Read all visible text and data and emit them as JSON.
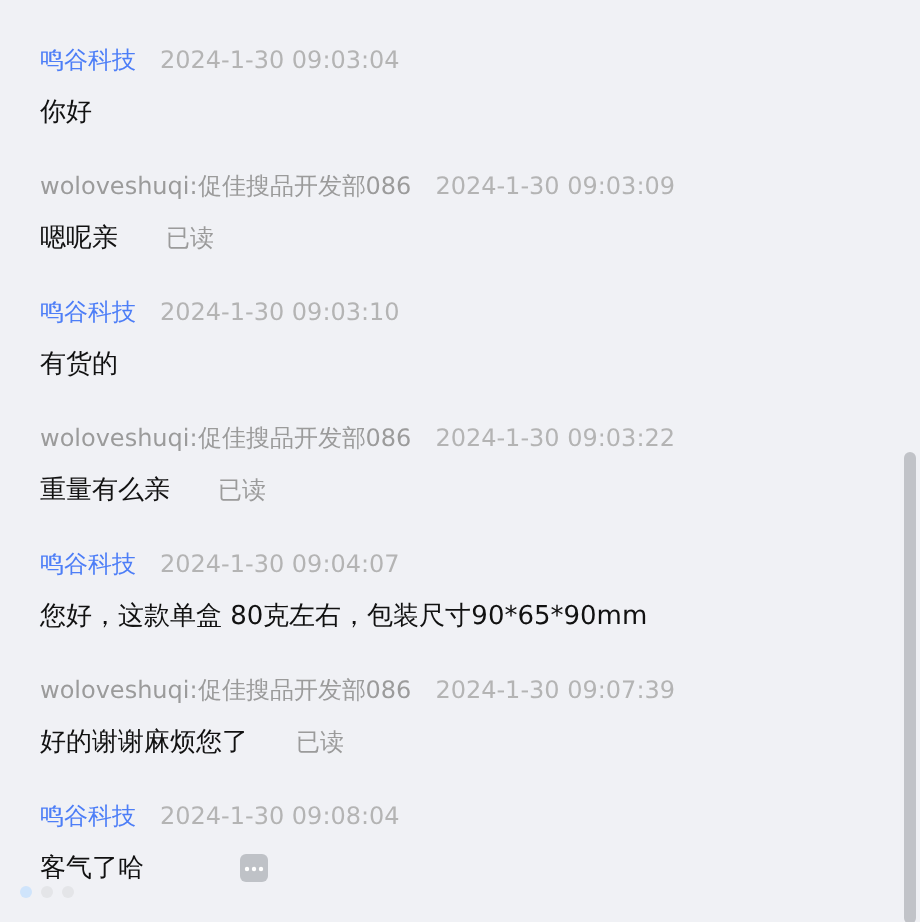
{
  "messages": [
    {
      "sender": "鸣谷科技",
      "kind": "shop",
      "time": "2024-1-30 09:03:04",
      "text": "你好"
    },
    {
      "sender": "woloveshuqi:促佳搜品开发部086",
      "kind": "customer",
      "time": "2024-1-30 09:03:09",
      "text": "嗯呢亲",
      "status": "已读"
    },
    {
      "sender": "鸣谷科技",
      "kind": "shop",
      "time": "2024-1-30 09:03:10",
      "text": "有货的"
    },
    {
      "sender": "woloveshuqi:促佳搜品开发部086",
      "kind": "customer",
      "time": "2024-1-30 09:03:22",
      "text": "重量有么亲",
      "status": "已读"
    },
    {
      "sender": "鸣谷科技",
      "kind": "shop",
      "time": "2024-1-30 09:04:07",
      "text": "您好，这款单盒 80克左右，包装尺寸90*65*90mm"
    },
    {
      "sender": "woloveshuqi:促佳搜品开发部086",
      "kind": "customer",
      "time": "2024-1-30 09:07:39",
      "text": "好的谢谢麻烦您了",
      "status": "已读"
    },
    {
      "sender": "鸣谷科技",
      "kind": "shop",
      "time": "2024-1-30 09:08:04",
      "text": "客气了哈",
      "more": true
    }
  ]
}
